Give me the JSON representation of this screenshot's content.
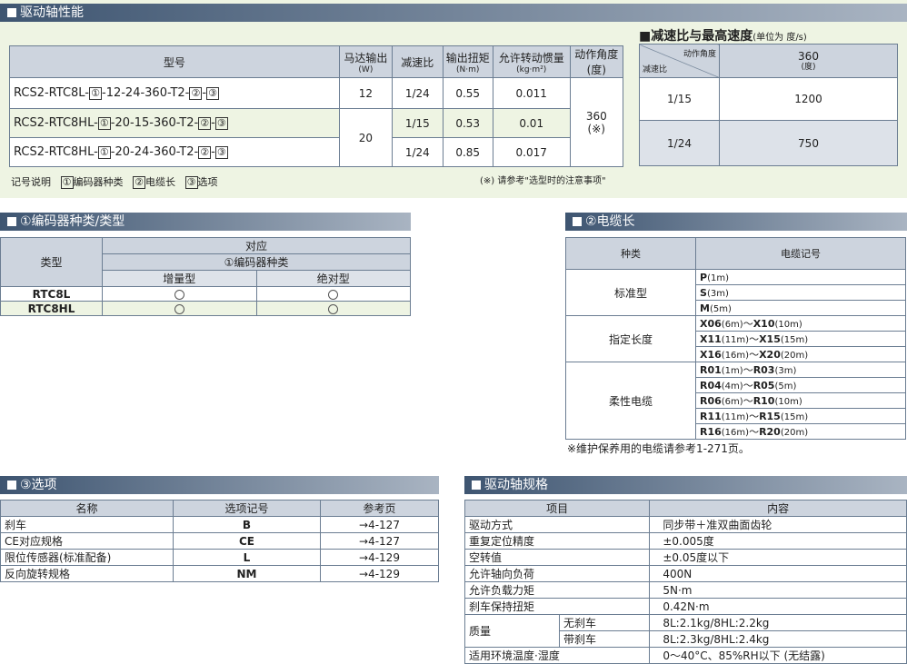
{
  "drive": {
    "title": "驱动轴性能",
    "headers": [
      "型号",
      "马达输出",
      "(W)",
      "减速比",
      "输出扭矩",
      "(N·m)",
      "允许转动惯量",
      "(kg·m²)",
      "动作角度",
      "(度)"
    ],
    "rows": [
      {
        "m1": "RCS2-RTC8L-",
        "m2": "-12-24-360-T2-",
        "m3": "-",
        "w": "12",
        "r": "1/24",
        "t": "0.55",
        "j": "0.011"
      },
      {
        "m1": "RCS2-RTC8HL-",
        "m2": "-20-15-360-T2-",
        "m3": "-",
        "w": "20",
        "r": "1/15",
        "t": "0.53",
        "j": "0.01"
      },
      {
        "m1": "RCS2-RTC8HL-",
        "m2": "-20-24-360-T2-",
        "m3": "-",
        "r": "1/24",
        "t": "0.85",
        "j": "0.017"
      }
    ],
    "angle": "360",
    "angle_note": "(※)",
    "legend": "记号说明",
    "legend_1": "编码器种类",
    "legend_2": "电缆长",
    "legend_3": "选项",
    "footnote": "(※) 请参考\"选型时的注意事项\"",
    "c1": "①",
    "c2": "②",
    "c3": "③"
  },
  "speed": {
    "title": "■减速比与最高速度",
    "unit": "(单位为 度/s)",
    "h_angle": "动作角度",
    "h_ratio": "减速比",
    "h_val": "360",
    "h_unit": "(度)",
    "rows": [
      {
        "r": "1/15",
        "v": "1200"
      },
      {
        "r": "1/24",
        "v": "750"
      }
    ]
  },
  "encoder": {
    "title": "①编码器种类/类型",
    "h_type": "类型",
    "h_corr": "对应",
    "h_enc": "①编码器种类",
    "h_inc": "增量型",
    "h_abs": "绝对型",
    "rows": [
      "RTC8L",
      "RTC8HL"
    ]
  },
  "cable": {
    "title": "②电缆长",
    "h_kind": "种类",
    "h_code": "电缆记号",
    "g1": "标准型",
    "g2": "指定长度",
    "g3": "柔性电缆",
    "rows": [
      {
        "a": "P",
        "al": "(1m)"
      },
      {
        "a": "S",
        "al": "(3m)"
      },
      {
        "a": "M",
        "al": "(5m)"
      },
      {
        "a": "X06",
        "al": "(6m)",
        "b": "X10",
        "bl": "(10m)"
      },
      {
        "a": "X11",
        "al": "(11m)",
        "b": "X15",
        "bl": "(15m)"
      },
      {
        "a": "X16",
        "al": "(16m)",
        "b": "X20",
        "bl": "(20m)"
      },
      {
        "a": "R01",
        "al": "(1m)",
        "b": "R03",
        "bl": "(3m)"
      },
      {
        "a": "R04",
        "al": "(4m)",
        "b": "R05",
        "bl": "(5m)"
      },
      {
        "a": "R06",
        "al": "(6m)",
        "b": "R10",
        "bl": "(10m)"
      },
      {
        "a": "R11",
        "al": "(11m)",
        "b": "R15",
        "bl": "(15m)"
      },
      {
        "a": "R16",
        "al": "(16m)",
        "b": "R20",
        "bl": "(20m)"
      }
    ],
    "tilde": "～",
    "note": "※维护保养用的电缆请参考1-271页。"
  },
  "options": {
    "title": "③选项",
    "h": [
      "名称",
      "选项记号",
      "参考页"
    ],
    "rows": [
      [
        "刹车",
        "B",
        "→4-127"
      ],
      [
        "CE对应规格",
        "CE",
        "→4-127"
      ],
      [
        "限位传感器(标准配备)",
        "L",
        "→4-129"
      ],
      [
        "反向旋转规格",
        "NM",
        "→4-129"
      ]
    ]
  },
  "spec": {
    "title": "驱动轴规格",
    "h": [
      "项目",
      "内容"
    ],
    "rows": [
      [
        "驱动方式",
        "同步带＋准双曲面齿轮"
      ],
      [
        "重复定位精度",
        "±0.005度"
      ],
      [
        "空转值",
        "±0.05度以下"
      ],
      [
        "允许轴向负荷",
        "400N"
      ],
      [
        "允许负载力矩",
        "5N·m"
      ],
      [
        "刹车保持扭矩",
        "0.42N·m"
      ]
    ],
    "mass": "质量",
    "nobrake": "无刹车",
    "nobrake_v": "8L:2.1kg/8HL:2.2kg",
    "brake": "带刹车",
    "brake_v": "8L:2.3kg/8HL:2.4kg",
    "env": "适用环境温度·湿度",
    "env_v": "0～40°C、85%RH以下 (无结露)"
  }
}
